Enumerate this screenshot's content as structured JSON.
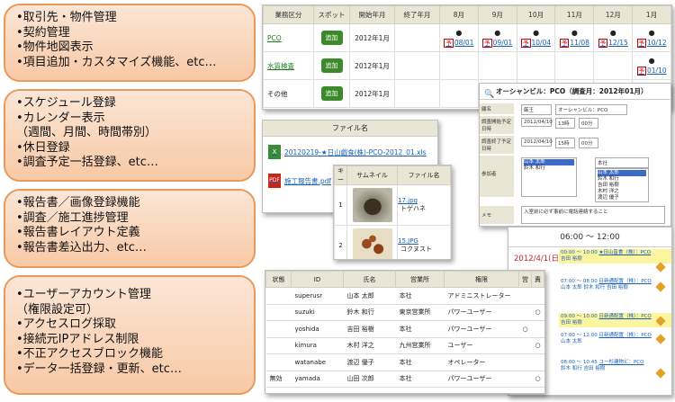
{
  "features": [
    {
      "lines": [
        "•取引先・物件管理",
        "•契約管理",
        "•物件地図表示",
        "•項目追加・カスタマイズ機能、etc…"
      ]
    },
    {
      "lines": [
        "•スケジュール登録",
        "•カレンダー表示",
        "（週間、月間、時間帯別）",
        "•休日登録",
        "•調査予定一括登録、etc…"
      ]
    },
    {
      "lines": [
        "•報告書／画像登録機能",
        "•調査／施工進捗管理",
        "•報告書レイアウト定義",
        "•報告書差込出力、etc…"
      ]
    },
    {
      "lines": [
        "•ユーザーアカウント管理",
        "（権限設定可）",
        "•アクセスログ採取",
        "•接続元IPアドレス制限",
        "•不正アクセスブロック機能",
        "•データ一括登録・更新、etc…"
      ]
    }
  ],
  "schedule": {
    "headers": [
      "業務区分",
      "スポット",
      "開始年月",
      "終了年月",
      "8月",
      "9月",
      "10月",
      "11月",
      "12月",
      "1月"
    ],
    "add_label": "追加",
    "rows": [
      {
        "name": "PCO",
        "start": "2012年1月",
        "months": [
          {
            "dot": "●",
            "event": "08/01"
          },
          {
            "dot": "●",
            "event": "09/01"
          },
          {
            "dot": "●",
            "event": "10/04"
          },
          {
            "dot": "●",
            "event": "11/08"
          },
          {
            "dot": "●",
            "event": "12/15"
          },
          {
            "dot": "●",
            "event": "10/12"
          }
        ]
      },
      {
        "name": "水質検査",
        "start": "2012年1月",
        "months": [
          {
            "dot": "",
            "event": ""
          },
          {
            "dot": "",
            "event": ""
          },
          {
            "dot": "",
            "event": ""
          },
          {
            "dot": "",
            "event": ""
          },
          {
            "dot": "",
            "event": ""
          },
          {
            "dot": "●",
            "event": "01/10"
          }
        ]
      },
      {
        "name": "その他",
        "start": "2012年1月",
        "months": []
      }
    ]
  },
  "files": {
    "header": "ファイル名",
    "items": [
      "20120219-★日山戯食(株)-PCO-2012_01.xls",
      "施工報告書.pdf"
    ]
  },
  "photos": {
    "headers": [
      "キー",
      "サムネイル",
      "ファイル名"
    ],
    "rows": [
      {
        "key": "1",
        "file": "17.jpg",
        "extra": "トゲハネ"
      },
      {
        "key": "2",
        "file": "15.JPG",
        "extra": "コクヌスト"
      }
    ]
  },
  "dialog": {
    "title": "オーシャンビル：PCO（調査月：2012年01月）",
    "labels": [
      "顧名",
      "調査開始予定日時",
      "調査終了予定日時",
      "参加者",
      "メモ"
    ],
    "company": "厳王",
    "building": "オーシャンビル：PCO",
    "start_date": "2012/04/10",
    "start_hour": "13時",
    "start_min": "00分",
    "end_date": "2012/04/10",
    "end_hour": "15時",
    "end_min": "00分",
    "members_left": [
      "山本 太郎",
      "鈴木 和行"
    ],
    "select_value": "本社",
    "members_right": [
      "山本 太郎",
      "鈴木 和行",
      "吉田 裕樹",
      "木村 洋之",
      "渡辺 優子"
    ],
    "memo": "入室前に必ず事前に電話連絡すること"
  },
  "users": {
    "headers": [
      "状態",
      "ID",
      "氏名",
      "営業所",
      "権限",
      "営",
      "責"
    ],
    "rows": [
      {
        "status": "",
        "id": "superusr",
        "name": "山本 太郎",
        "office": "本社",
        "role": "アドミニストレーター",
        "a": "",
        "b": ""
      },
      {
        "status": "",
        "id": "suzuki",
        "name": "鈴木 和行",
        "office": "東京営業所",
        "role": "パワーユーザー",
        "a": "",
        "b": "○"
      },
      {
        "status": "",
        "id": "yoshida",
        "name": "吉田 裕樹",
        "office": "本社",
        "role": "パワーユーザー",
        "a": "○",
        "b": ""
      },
      {
        "status": "",
        "id": "kimura",
        "name": "木村 洋之",
        "office": "九州営業所",
        "role": "ユーザー",
        "a": "",
        "b": "○"
      },
      {
        "status": "",
        "id": "watanabe",
        "name": "渡辺 優子",
        "office": "本社",
        "role": "オペレーター",
        "a": "",
        "b": ""
      },
      {
        "status": "無効",
        "id": "yamada",
        "name": "山田 次郎",
        "office": "本社",
        "role": "パワーユーザー",
        "a": "",
        "b": "○"
      }
    ]
  },
  "calendar": {
    "header": "06:00 ～ 12:00",
    "date": "2012/4/1(日)",
    "events": [
      {
        "time": "00:00 ～ 10:00",
        "title": "★日山皆食（株）：PCO",
        "people": "吉田 裕樹"
      },
      {
        "time": "07:00 ～ 08:00",
        "title": "日新通配置（株）：PCO",
        "people": "山本 太郎 鈴木 和行 吉田 裕樹"
      },
      {
        "time": "09:00 ～ 10:00",
        "title": "日新通配置（株）：PCO",
        "people": "吉田 裕樹"
      },
      {
        "time": "07:00 ～ 12:00",
        "title": "日新通配置（株）：PCO",
        "people": "山本 太郎"
      },
      {
        "time": "08:00 ～ 10:45",
        "title": "ユー杉建物ビ：PCO",
        "people": "鈴木 和行 吉田 裕樹"
      }
    ]
  },
  "colors": {
    "feature_border": "#e89a5c",
    "feature_fill": "#f7c9a6",
    "header_bg": "#e9e6d6",
    "add_button": "#3d8a2b",
    "link": "#1a5fb5",
    "date_red": "#c0292e",
    "highlight": "#fbf5a0"
  }
}
